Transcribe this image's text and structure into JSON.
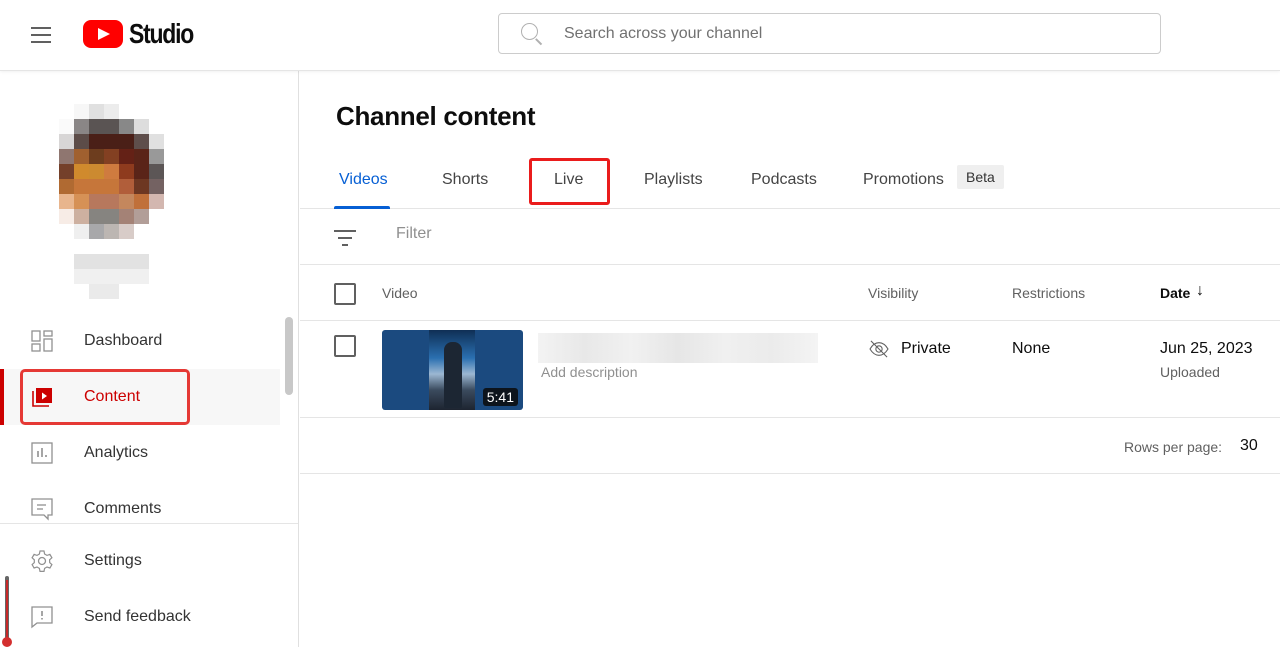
{
  "header": {
    "app_name": "Studio",
    "search_placeholder": "Search across your channel"
  },
  "sidebar": {
    "items": [
      {
        "label": "Dashboard",
        "icon": "dashboard-icon",
        "active": false
      },
      {
        "label": "Content",
        "icon": "content-icon",
        "active": true
      },
      {
        "label": "Analytics",
        "icon": "analytics-icon",
        "active": false
      },
      {
        "label": "Comments",
        "icon": "comments-icon",
        "active": false
      }
    ],
    "footer_items": [
      {
        "label": "Settings",
        "icon": "gear-icon"
      },
      {
        "label": "Send feedback",
        "icon": "feedback-icon"
      }
    ]
  },
  "main": {
    "title": "Channel content",
    "tabs": [
      {
        "label": "Videos",
        "active": true
      },
      {
        "label": "Shorts"
      },
      {
        "label": "Live"
      },
      {
        "label": "Playlists"
      },
      {
        "label": "Podcasts"
      },
      {
        "label": "Promotions"
      }
    ],
    "beta_badge": "Beta",
    "filter_placeholder": "Filter",
    "columns": {
      "video": "Video",
      "visibility": "Visibility",
      "restrictions": "Restrictions",
      "date": "Date",
      "date_sort": "↓"
    },
    "rows": [
      {
        "duration": "5:41",
        "description": "Add description",
        "visibility": "Private",
        "restrictions": "None",
        "date": "Jun 25, 2023",
        "date_status": "Uploaded"
      }
    ],
    "pagination": {
      "rows_per_page_label": "Rows per page:",
      "rows_per_page": "30"
    }
  },
  "colors": {
    "brand_red": "#ff0000",
    "active_red": "#cc0000",
    "tab_blue": "#065fd4",
    "highlight_red": "#ea1c1c"
  }
}
